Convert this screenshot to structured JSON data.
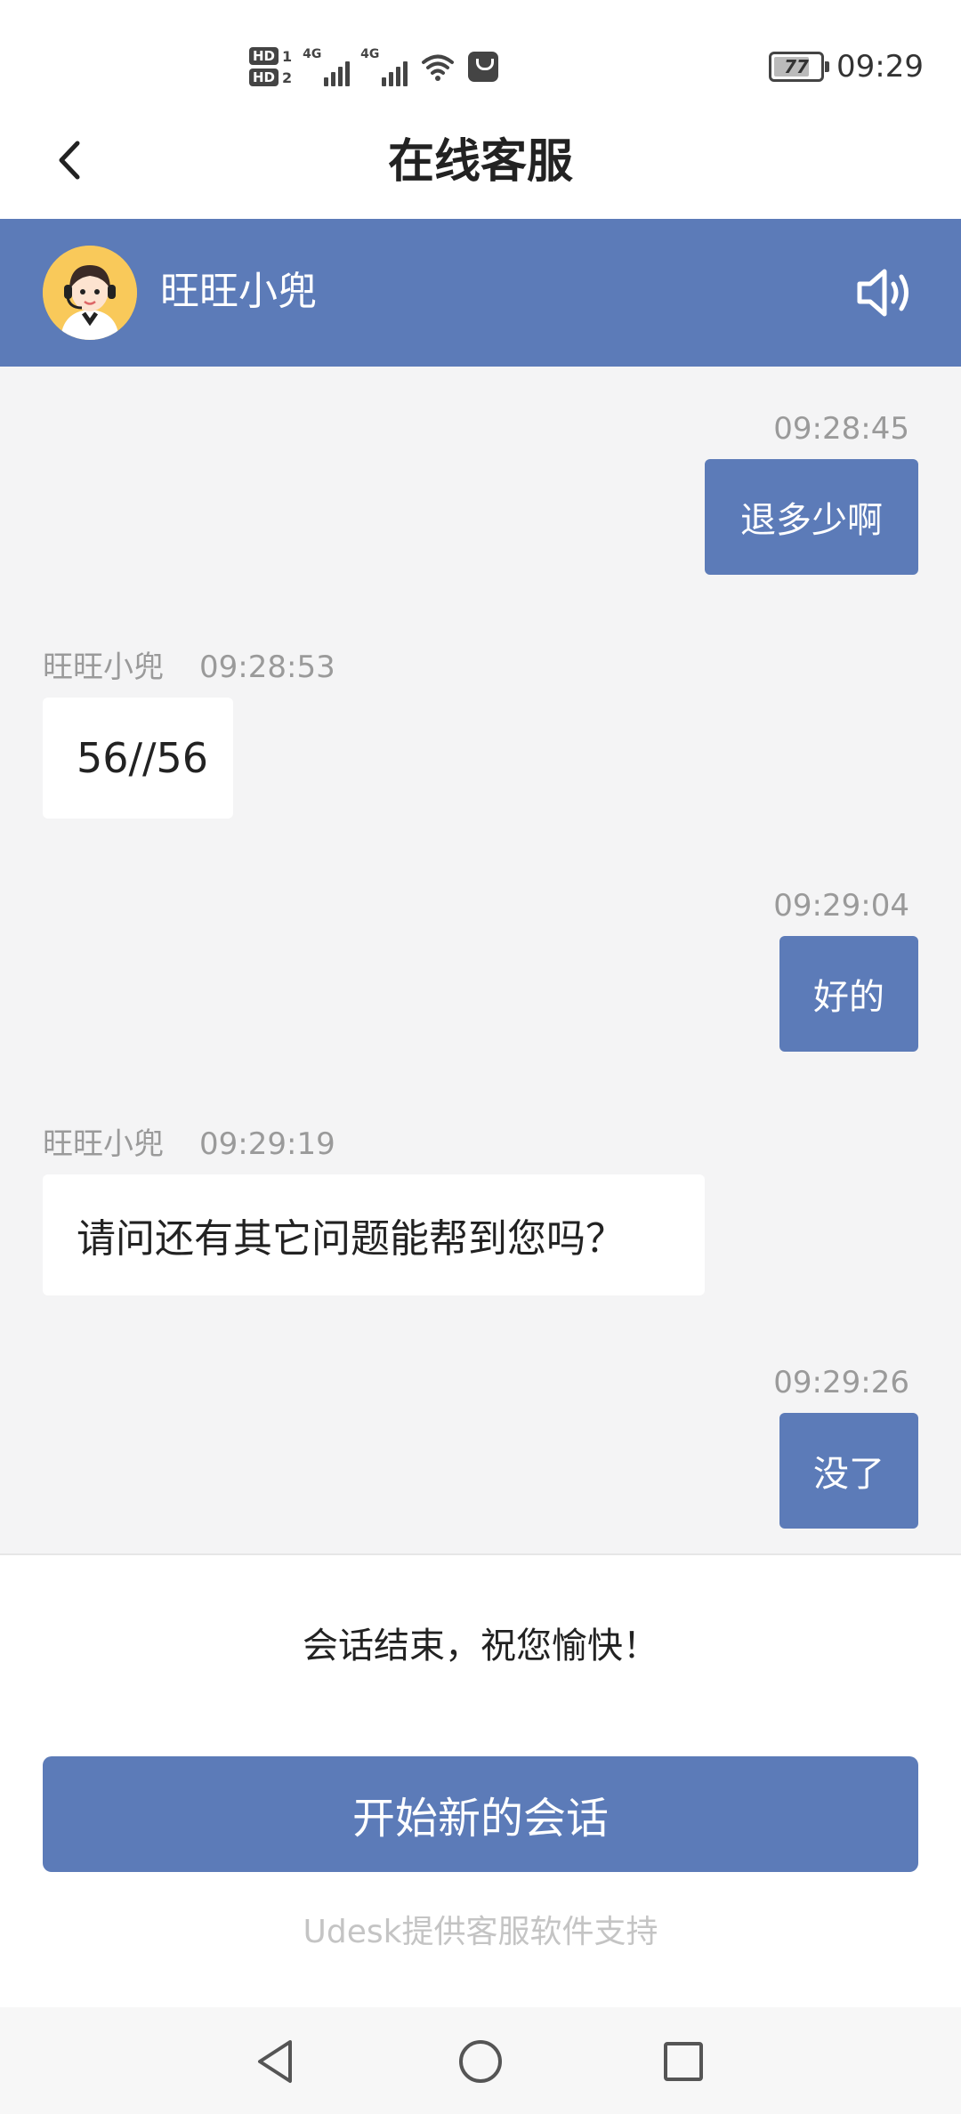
{
  "status_bar": {
    "hd1": "HD",
    "hd1_num": "1",
    "hd2": "HD",
    "hd2_num": "2",
    "net1": "4G",
    "net2": "4G",
    "battery": "77",
    "battery_level_percent": 77,
    "time": "09:29"
  },
  "header": {
    "title": "在线客服",
    "back_icon": "chevron-left-icon"
  },
  "agent": {
    "name": "旺旺小兜",
    "avatar_icon": "customer-service-avatar",
    "speaker_icon": "speaker-icon"
  },
  "messages": [
    {
      "direction": "out",
      "time": "09:28:45",
      "text": "退多少啊"
    },
    {
      "direction": "in",
      "sender": "旺旺小兜",
      "time": "09:28:53",
      "text": "56//56"
    },
    {
      "direction": "out",
      "time": "09:29:04",
      "text": "好的"
    },
    {
      "direction": "in",
      "sender": "旺旺小兜",
      "time": "09:29:19",
      "text": "请问还有其它问题能帮到您吗？"
    },
    {
      "direction": "out",
      "time": "09:29:26",
      "text": "没了"
    }
  ],
  "footer": {
    "end_text": "会话结束，祝您愉快！",
    "new_chat_label": "开始新的会话",
    "powered_by": "Udesk提供客服软件支持"
  },
  "nav": {
    "back_icon": "triangle-back-icon",
    "home_icon": "circle-home-icon",
    "recents_icon": "square-recents-icon"
  },
  "colors": {
    "accent": "#5c7bb8",
    "chat_bg": "#f4f4f5",
    "meta_text": "#9a9a9a"
  }
}
